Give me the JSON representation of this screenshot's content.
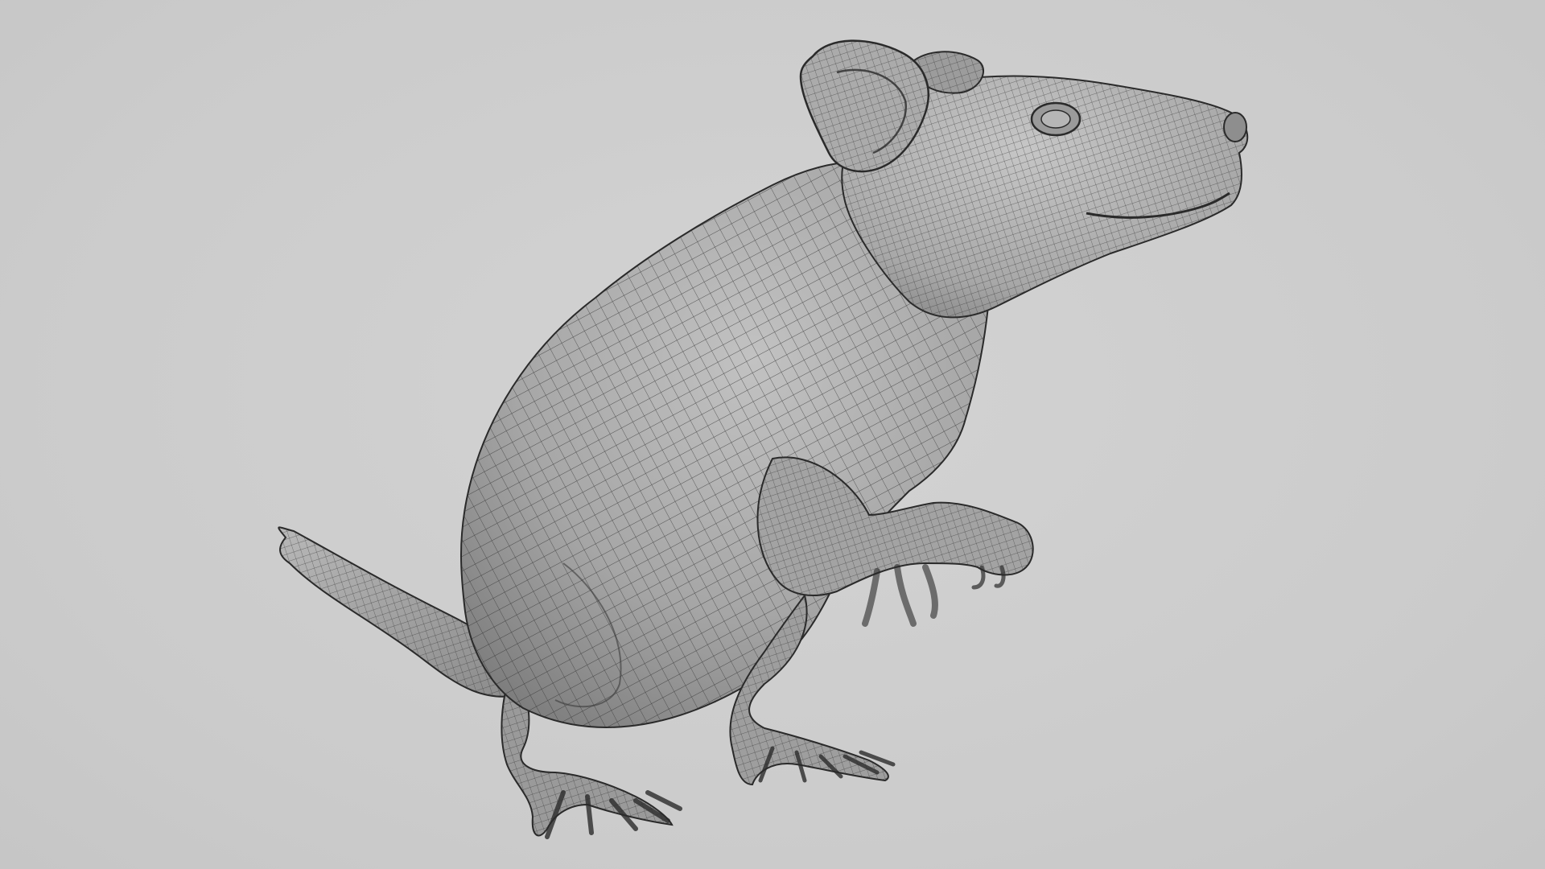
{
  "scene": {
    "subject": "",
    "background_color": "#cfcfcf",
    "mesh_shade_light": "#b4b4b4",
    "mesh_shade_dark": "#7c7c7c",
    "wire_color": "#2a2a2a"
  }
}
